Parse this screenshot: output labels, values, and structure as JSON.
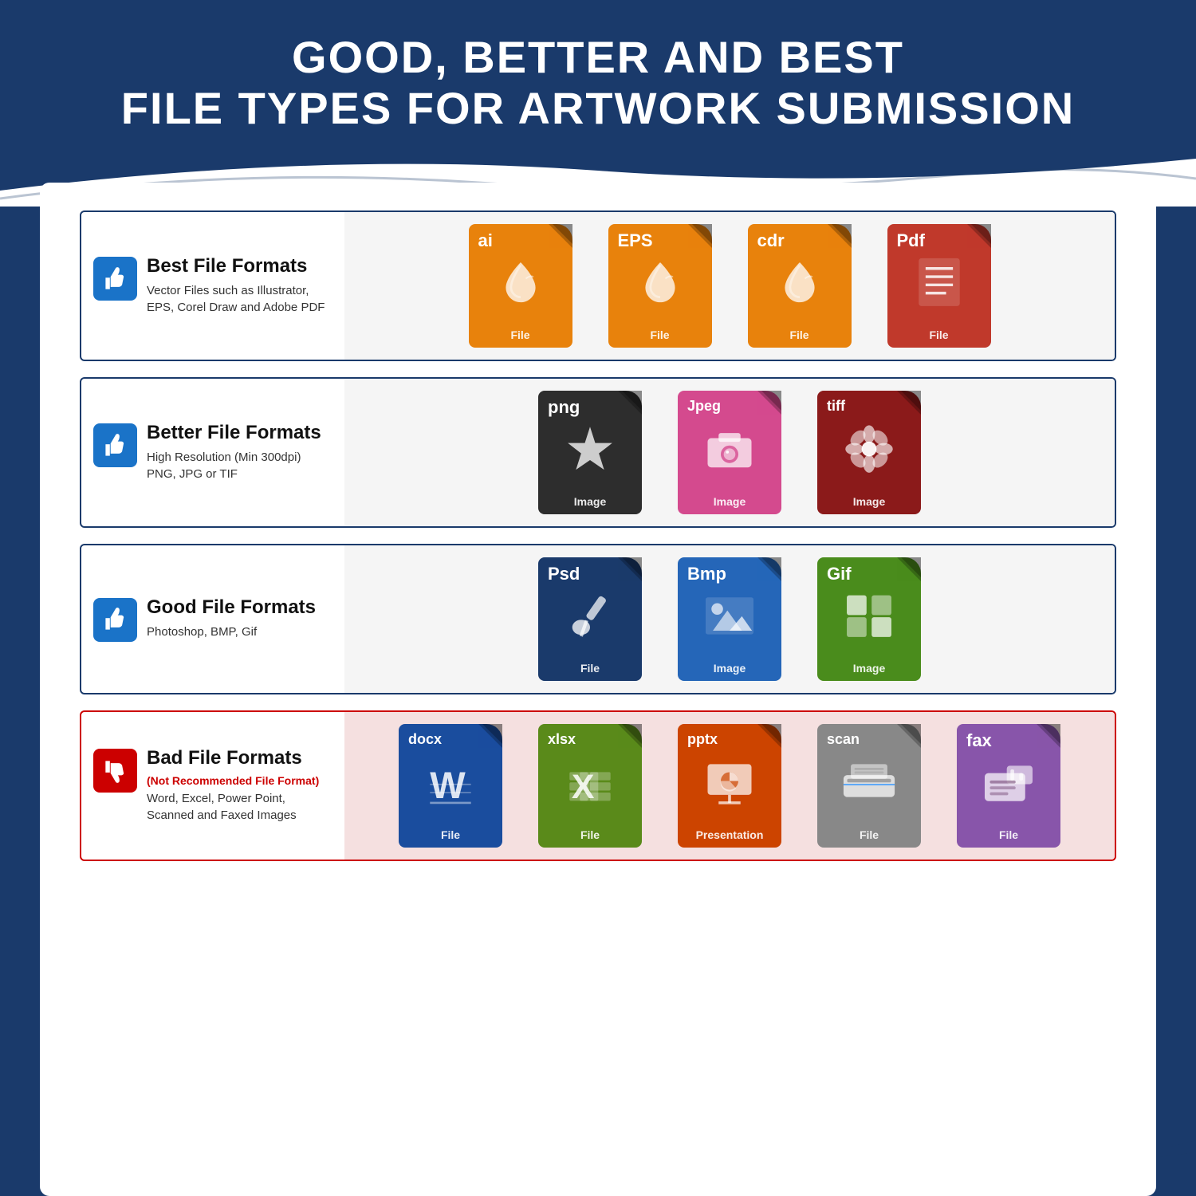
{
  "header": {
    "line1": "GOOD, BETTER AND BEST",
    "line2": "FILE TYPES FOR ARTWORK SUBMISSION"
  },
  "rows": [
    {
      "id": "best",
      "thumbsUp": true,
      "bad": false,
      "label": "Best File Formats",
      "subtitle": null,
      "description": "Vector Files such as Illustrator,\nEPS, Corel Draw and Adobe PDF",
      "files": [
        {
          "ext": "ai",
          "color": "orange",
          "label": "File",
          "icon": "inkdrop"
        },
        {
          "ext": "EPS",
          "color": "orange",
          "label": "File",
          "icon": "inkdrop"
        },
        {
          "ext": "cdr",
          "color": "orange",
          "label": "File",
          "icon": "inkdrop"
        },
        {
          "ext": "Pdf",
          "color": "red-file",
          "label": "File",
          "icon": "doclines"
        }
      ]
    },
    {
      "id": "better",
      "thumbsUp": true,
      "bad": false,
      "label": "Better File Formats",
      "subtitle": null,
      "description": "High Resolution (Min 300dpi)\nPNG, JPG or TIF",
      "files": [
        {
          "ext": "png",
          "color": "dark-gray",
          "label": "Image",
          "icon": "starburst"
        },
        {
          "ext": "Jpeg",
          "color": "pink",
          "label": "Image",
          "icon": "camera"
        },
        {
          "ext": "tiff",
          "color": "dark-red",
          "label": "Image",
          "icon": "flower"
        }
      ]
    },
    {
      "id": "good",
      "thumbsUp": true,
      "bad": false,
      "label": "Good File Formats",
      "subtitle": null,
      "description": "Photoshop, BMP, Gif",
      "files": [
        {
          "ext": "Psd",
          "color": "navy",
          "label": "File",
          "icon": "brush"
        },
        {
          "ext": "Bmp",
          "color": "blue",
          "label": "Image",
          "icon": "mountain"
        },
        {
          "ext": "Gif",
          "color": "green",
          "label": "Image",
          "icon": "grid"
        }
      ]
    },
    {
      "id": "bad",
      "thumbsUp": false,
      "bad": true,
      "label": "Bad File Formats",
      "subtitle": "(Not Recommended File Format)",
      "description": "Word, Excel, Power Point,\nScanned and Faxed Images",
      "files": [
        {
          "ext": "docx",
          "color": "docx-blue",
          "label": "File",
          "icon": "wletter"
        },
        {
          "ext": "xlsx",
          "color": "xlsx-green",
          "label": "File",
          "icon": "xletter"
        },
        {
          "ext": "pptx",
          "color": "pptx-orange",
          "label": "Presentation",
          "icon": "presentation"
        },
        {
          "ext": "scan",
          "color": "scan-gray",
          "label": "File",
          "icon": "scanner"
        },
        {
          "ext": "fax",
          "color": "fax-purple",
          "label": "File",
          "icon": "faxicon"
        }
      ]
    }
  ]
}
